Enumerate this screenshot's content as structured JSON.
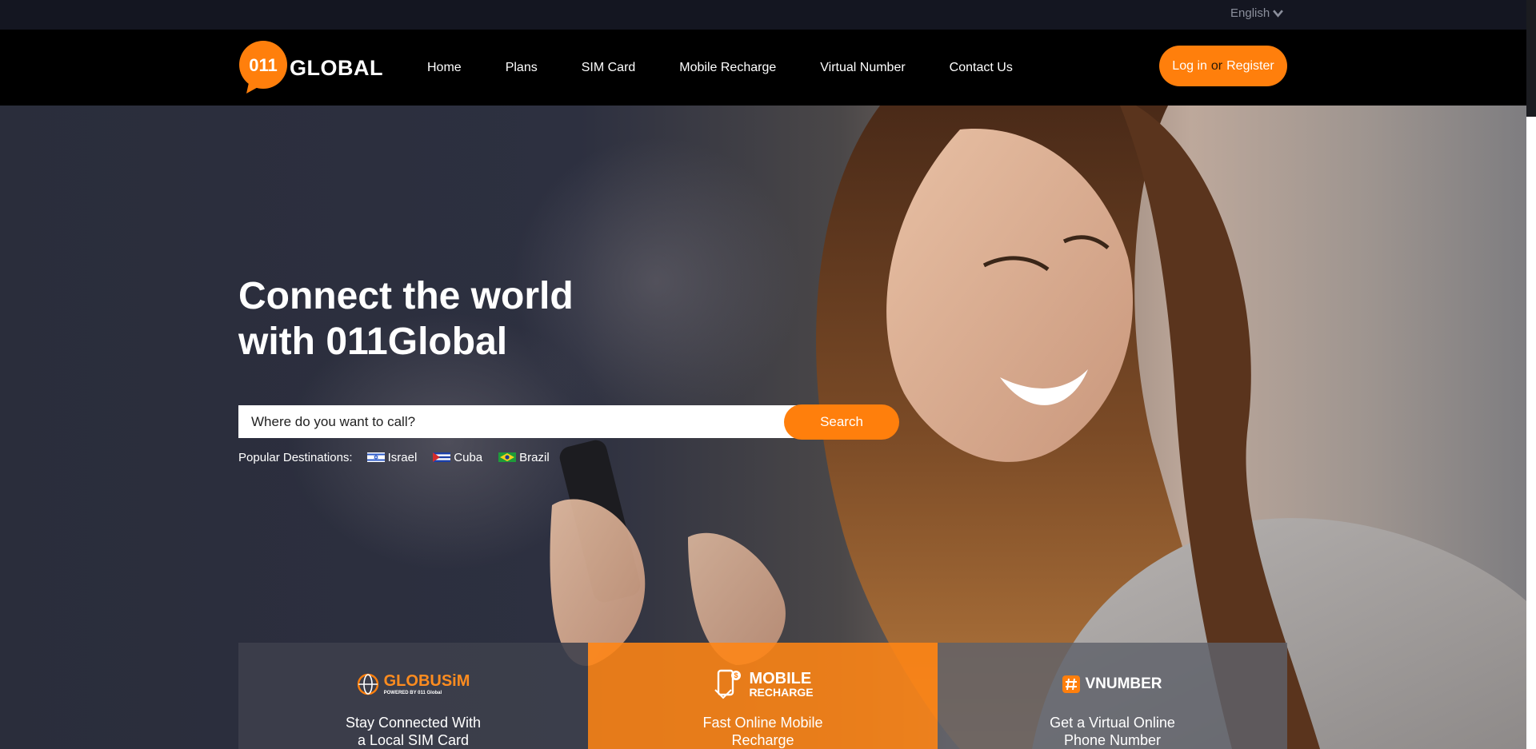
{
  "topbar": {
    "language": "English"
  },
  "nav": {
    "logo_text": "GLOBAL",
    "logo_mark": "011",
    "links": [
      "Home",
      "Plans",
      "SIM Card",
      "Mobile Recharge",
      "Virtual Number",
      "Contact Us"
    ],
    "login": "Log in",
    "or": "or",
    "register": "Register"
  },
  "hero": {
    "title_line1": "Connect the world",
    "title_line2": "with 011Global",
    "search_placeholder": "Where do you want to call?",
    "search_button": "Search",
    "popular_label": "Popular Destinations:",
    "destinations": [
      "Israel",
      "Cuba",
      "Brazil"
    ]
  },
  "cards": [
    {
      "logo": "GLOBUSiM",
      "logo_sub": "POWERED BY 011 Global",
      "title_line1": "Stay Connected With",
      "title_line2": "a Local SIM Card"
    },
    {
      "logo": "MOBILE",
      "logo_sub": "RECHARGE",
      "title_line1": "Fast Online Mobile",
      "title_line2": "Recharge"
    },
    {
      "logo": "VNUMBER",
      "logo_sub": "",
      "title_line1": "Get a Virtual Online",
      "title_line2": "Phone Number"
    }
  ],
  "colors": {
    "accent": "#ff7f0c",
    "nav_bg": "#000000",
    "topbar_bg": "#141621"
  }
}
